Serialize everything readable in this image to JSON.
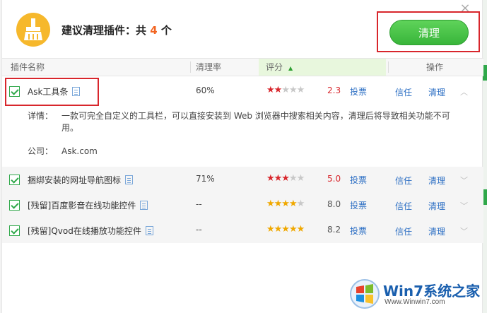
{
  "header": {
    "title_prefix": "建议清理插件：共",
    "count": "4",
    "title_suffix": "个",
    "clean_button": "清理",
    "close_symbol": "×"
  },
  "columns": {
    "name": "插件名称",
    "rate": "清理率",
    "score": "评分",
    "action": "操作"
  },
  "rows": [
    {
      "name": "Ask工具条",
      "rate": "60%",
      "stars": 1.5,
      "score": "2.3",
      "vote": "投票",
      "trust": "信任",
      "clean": "清理",
      "details_label": "详情：",
      "details": "一款可完全自定义的工具栏，可以直接安装到 Web 浏览器中搜索相关内容，清理后将导致相关功能不可用。",
      "company_label": "公司：",
      "company": "Ask.com"
    },
    {
      "name": "捆绑安装的网址导航图标",
      "rate": "71%",
      "stars": 2.5,
      "score": "5.0",
      "vote": "投票",
      "trust": "信任",
      "clean": "清理"
    },
    {
      "name": "[残留]百度影音在线功能控件",
      "rate": "--",
      "stars": 4,
      "score": "8.0",
      "vote": "投票",
      "trust": "信任",
      "clean": "清理"
    },
    {
      "name": "[残留]Qvod在线播放功能控件",
      "rate": "--",
      "stars": 4.5,
      "score": "8.2",
      "vote": "投票",
      "trust": "信任",
      "clean": "清理"
    }
  ],
  "watermark": {
    "brand": "Win7系统之家",
    "url": "Www.Winwin7.com"
  },
  "colors": {
    "accent_green": "#38b53a",
    "highlight_red": "#d8262c",
    "link_blue": "#2d6fc4",
    "logo_orange": "#f6b82c"
  }
}
